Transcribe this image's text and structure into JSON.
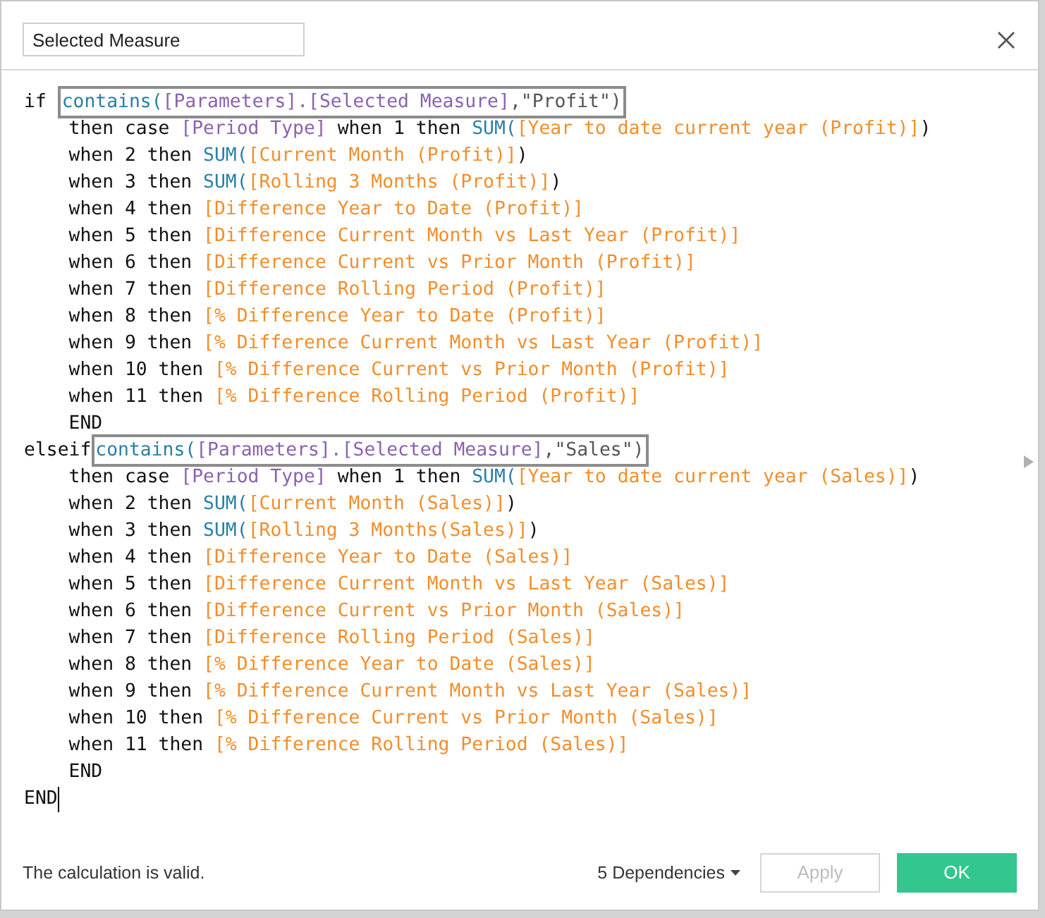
{
  "name_field": {
    "value": "Selected Measure"
  },
  "code": [
    {
      "cursor": false,
      "segments": [
        {
          "kind": "plain",
          "tokens": [
            {
              "kind": "keyword",
              "text": "if "
            }
          ]
        },
        {
          "kind": "boxed",
          "tokens": [
            {
              "kind": "function",
              "text": "contains("
            },
            {
              "kind": "param",
              "text": "[Parameters].[Selected Measure]"
            },
            {
              "kind": "string",
              "text": ",\"Profit\")"
            }
          ]
        }
      ]
    },
    {
      "cursor": false,
      "segments": [
        {
          "kind": "plain",
          "tokens": [
            {
              "kind": "keyword",
              "text": "    then case "
            },
            {
              "kind": "param",
              "text": "[Period Type]"
            },
            {
              "kind": "keyword",
              "text": " when 1 then "
            },
            {
              "kind": "function",
              "text": "SUM("
            },
            {
              "kind": "field",
              "text": "[Year to date current year (Profit)]"
            },
            {
              "kind": "keyword",
              "text": ")"
            }
          ]
        }
      ]
    },
    {
      "cursor": false,
      "segments": [
        {
          "kind": "plain",
          "tokens": [
            {
              "kind": "keyword",
              "text": "    when 2 then "
            },
            {
              "kind": "function",
              "text": "SUM("
            },
            {
              "kind": "field",
              "text": "[Current Month (Profit)]"
            },
            {
              "kind": "keyword",
              "text": ")"
            }
          ]
        }
      ]
    },
    {
      "cursor": false,
      "segments": [
        {
          "kind": "plain",
          "tokens": [
            {
              "kind": "keyword",
              "text": "    when 3 then "
            },
            {
              "kind": "function",
              "text": "SUM("
            },
            {
              "kind": "field",
              "text": "[Rolling 3 Months (Profit)]"
            },
            {
              "kind": "keyword",
              "text": ")"
            }
          ]
        }
      ]
    },
    {
      "cursor": false,
      "segments": [
        {
          "kind": "plain",
          "tokens": [
            {
              "kind": "keyword",
              "text": "    when 4 then "
            },
            {
              "kind": "field",
              "text": "[Difference Year to Date (Profit)]"
            }
          ]
        }
      ]
    },
    {
      "cursor": false,
      "segments": [
        {
          "kind": "plain",
          "tokens": [
            {
              "kind": "keyword",
              "text": "    when 5 then "
            },
            {
              "kind": "field",
              "text": "[Difference Current Month vs Last Year (Profit)]"
            }
          ]
        }
      ]
    },
    {
      "cursor": false,
      "segments": [
        {
          "kind": "plain",
          "tokens": [
            {
              "kind": "keyword",
              "text": "    when 6 then "
            },
            {
              "kind": "field",
              "text": "[Difference Current vs Prior Month (Profit)]"
            }
          ]
        }
      ]
    },
    {
      "cursor": false,
      "segments": [
        {
          "kind": "plain",
          "tokens": [
            {
              "kind": "keyword",
              "text": "    when 7 then "
            },
            {
              "kind": "field",
              "text": "[Difference Rolling Period (Profit)]"
            }
          ]
        }
      ]
    },
    {
      "cursor": false,
      "segments": [
        {
          "kind": "plain",
          "tokens": [
            {
              "kind": "keyword",
              "text": "    when 8 then "
            },
            {
              "kind": "field",
              "text": "[% Difference Year to Date (Profit)]"
            }
          ]
        }
      ]
    },
    {
      "cursor": false,
      "segments": [
        {
          "kind": "plain",
          "tokens": [
            {
              "kind": "keyword",
              "text": "    when 9 then "
            },
            {
              "kind": "field",
              "text": "[% Difference Current Month vs Last Year (Profit)]"
            }
          ]
        }
      ]
    },
    {
      "cursor": false,
      "segments": [
        {
          "kind": "plain",
          "tokens": [
            {
              "kind": "keyword",
              "text": "    when 10 then "
            },
            {
              "kind": "field",
              "text": "[% Difference Current vs Prior Month (Profit)]"
            }
          ]
        }
      ]
    },
    {
      "cursor": false,
      "segments": [
        {
          "kind": "plain",
          "tokens": [
            {
              "kind": "keyword",
              "text": "    when 11 then "
            },
            {
              "kind": "field",
              "text": "[% Difference Rolling Period (Profit)]"
            }
          ]
        }
      ]
    },
    {
      "cursor": false,
      "segments": [
        {
          "kind": "plain",
          "tokens": [
            {
              "kind": "keyword",
              "text": "    END"
            }
          ]
        }
      ]
    },
    {
      "cursor": false,
      "segments": [
        {
          "kind": "plain",
          "tokens": [
            {
              "kind": "keyword",
              "text": "elseif"
            }
          ]
        },
        {
          "kind": "boxed",
          "tokens": [
            {
              "kind": "function",
              "text": "contains("
            },
            {
              "kind": "param",
              "text": "[Parameters].[Selected Measure]"
            },
            {
              "kind": "string",
              "text": ",\"Sales\")"
            }
          ]
        }
      ]
    },
    {
      "cursor": false,
      "segments": [
        {
          "kind": "plain",
          "tokens": [
            {
              "kind": "keyword",
              "text": "    then case "
            },
            {
              "kind": "param",
              "text": "[Period Type]"
            },
            {
              "kind": "keyword",
              "text": " when 1 then "
            },
            {
              "kind": "function",
              "text": "SUM("
            },
            {
              "kind": "field",
              "text": "[Year to date current year (Sales)]"
            },
            {
              "kind": "keyword",
              "text": ")"
            }
          ]
        }
      ]
    },
    {
      "cursor": false,
      "segments": [
        {
          "kind": "plain",
          "tokens": [
            {
              "kind": "keyword",
              "text": "    when 2 then "
            },
            {
              "kind": "function",
              "text": "SUM("
            },
            {
              "kind": "field",
              "text": "[Current Month (Sales)]"
            },
            {
              "kind": "keyword",
              "text": ")"
            }
          ]
        }
      ]
    },
    {
      "cursor": false,
      "segments": [
        {
          "kind": "plain",
          "tokens": [
            {
              "kind": "keyword",
              "text": "    when 3 then "
            },
            {
              "kind": "function",
              "text": "SUM("
            },
            {
              "kind": "field",
              "text": "[Rolling 3 Months(Sales)]"
            },
            {
              "kind": "keyword",
              "text": ")"
            }
          ]
        }
      ]
    },
    {
      "cursor": false,
      "segments": [
        {
          "kind": "plain",
          "tokens": [
            {
              "kind": "keyword",
              "text": "    when 4 then "
            },
            {
              "kind": "field",
              "text": "[Difference Year to Date (Sales)]"
            }
          ]
        }
      ]
    },
    {
      "cursor": false,
      "segments": [
        {
          "kind": "plain",
          "tokens": [
            {
              "kind": "keyword",
              "text": "    when 5 then "
            },
            {
              "kind": "field",
              "text": "[Difference Current Month vs Last Year (Sales)]"
            }
          ]
        }
      ]
    },
    {
      "cursor": false,
      "segments": [
        {
          "kind": "plain",
          "tokens": [
            {
              "kind": "keyword",
              "text": "    when 6 then "
            },
            {
              "kind": "field",
              "text": "[Difference Current vs Prior Month (Sales)]"
            }
          ]
        }
      ]
    },
    {
      "cursor": false,
      "segments": [
        {
          "kind": "plain",
          "tokens": [
            {
              "kind": "keyword",
              "text": "    when 7 then "
            },
            {
              "kind": "field",
              "text": "[Difference Rolling Period (Sales)]"
            }
          ]
        }
      ]
    },
    {
      "cursor": false,
      "segments": [
        {
          "kind": "plain",
          "tokens": [
            {
              "kind": "keyword",
              "text": "    when 8 then "
            },
            {
              "kind": "field",
              "text": "[% Difference Year to Date (Sales)]"
            }
          ]
        }
      ]
    },
    {
      "cursor": false,
      "segments": [
        {
          "kind": "plain",
          "tokens": [
            {
              "kind": "keyword",
              "text": "    when 9 then "
            },
            {
              "kind": "field",
              "text": "[% Difference Current Month vs Last Year (Sales)]"
            }
          ]
        }
      ]
    },
    {
      "cursor": false,
      "segments": [
        {
          "kind": "plain",
          "tokens": [
            {
              "kind": "keyword",
              "text": "    when 10 then "
            },
            {
              "kind": "field",
              "text": "[% Difference Current vs Prior Month (Sales)]"
            }
          ]
        }
      ]
    },
    {
      "cursor": false,
      "segments": [
        {
          "kind": "plain",
          "tokens": [
            {
              "kind": "keyword",
              "text": "    when 11 then "
            },
            {
              "kind": "field",
              "text": "[% Difference Rolling Period (Sales)]"
            }
          ]
        }
      ]
    },
    {
      "cursor": false,
      "segments": [
        {
          "kind": "plain",
          "tokens": [
            {
              "kind": "keyword",
              "text": "    END"
            }
          ]
        }
      ]
    },
    {
      "cursor": true,
      "segments": [
        {
          "kind": "plain",
          "tokens": [
            {
              "kind": "keyword",
              "text": "END"
            }
          ]
        }
      ]
    }
  ],
  "status": "The calculation is valid.",
  "dependencies": "5 Dependencies",
  "buttons": [
    {
      "label": "Apply",
      "disabled": true
    },
    {
      "label": "OK",
      "disabled": false
    }
  ]
}
